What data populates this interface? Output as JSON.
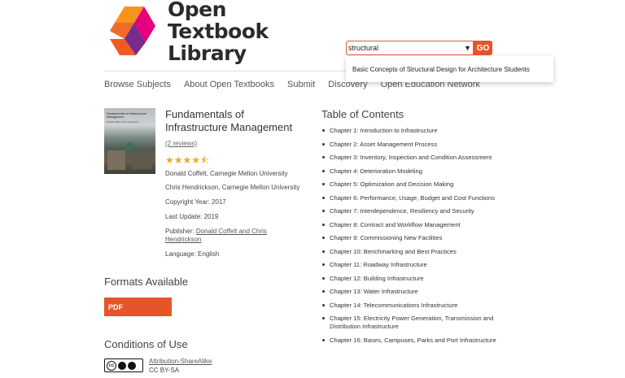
{
  "header": {
    "logo_text_line1": "Open Textbook",
    "logo_text_line2": "Library",
    "search": {
      "value": "structural",
      "go_label": "GO"
    },
    "suggestion": "Basic Concepts of Structural Design for Architecture Students"
  },
  "nav": [
    "Browse Subjects",
    "About Open Textbooks",
    "Submit",
    "Discovery",
    "Open Education Network"
  ],
  "book": {
    "cover_title": "Fundamentals of Infrastructure Management",
    "cover_subtitle": "Donald Coffelt / Chris Hendrickson",
    "title": "Fundamentals of Infrastructure Management",
    "reviews": "(2 reviews)",
    "rating": 4.5,
    "stars": "★★★★⯪",
    "author1": "Donald Coffelt, Carnegie Mellon University",
    "author2": "Chris Hendrickson, Carnegie Mellon University",
    "copyright": "Copyright Year: 2017",
    "last_update": "Last Update: 2019",
    "publisher_label": "Publisher:",
    "publisher": "Donald Coffelt and Chris Hendrickson",
    "language": "Language: English"
  },
  "formats": {
    "heading": "Formats Available",
    "pdf_label": "PDF"
  },
  "conditions": {
    "heading": "Conditions of Use",
    "cc_badge": "cc",
    "license_link": "Attribution-ShareAlike",
    "license_short": "CC BY-SA"
  },
  "toc": {
    "heading": "Table of Contents",
    "items": [
      "Chapter 1: Introduction to Infrastructure",
      "Chapter 2: Asset Management Process",
      "Chapter 3: Inventory, Inspection and Condition Assessment",
      "Chapter 4: Deterioration Modeling",
      "Chapter 5: Optimization and Decision Making",
      "Chapter 6: Performance, Usage, Budget and Cost Functions",
      "Chapter 7: Interdependence, Resiliency and Security",
      "Chapter 8: Contract and Workflow Management",
      "Chapter 9: Commissioning New Facilities",
      "Chapter 10: Benchmarking and Best Practices",
      "Chapter 11: Roadway Infrastructure",
      "Chapter 12: Building Infrastructure",
      "Chapter 13: Water Infrastructure",
      "Chapter 14: Telecommunications Infrastructure",
      "Chapter 15: Electricity Power Generation, Transmission and Distribution Infrastructure",
      "Chapter 16: Bases, Campuses, Parks and Port Infrastructure"
    ]
  },
  "colors": {
    "accent": "#e8542a",
    "logo_orange": "#f7941d",
    "logo_magenta": "#e6007e",
    "logo_purple": "#7a2a8a"
  }
}
